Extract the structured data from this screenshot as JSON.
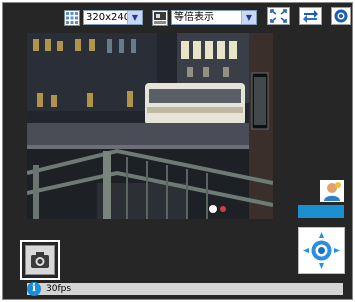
{
  "toolbar": {
    "resolution_icon": "resolution-grid-icon",
    "resolution_value": "320x240",
    "display_mode_icon": "display-mode-icon",
    "display_mode_value": "等倍表示",
    "fullscreen_icon": "fullscreen-icon",
    "swap_icon": "swap-arrows-icon",
    "settings_icon": "camera-settings-icon"
  },
  "video": {
    "alt": "Live camera feed: night street with bus and overpass"
  },
  "side": {
    "user_icon": "user-avatar-icon",
    "bar_color": "#1c8fd0",
    "joystick_icon": "pan-tilt-crosshair-icon"
  },
  "snapshot": {
    "icon": "camera-snapshot-icon"
  },
  "status": {
    "icon": "info-icon",
    "info_glyph": "i",
    "text": "30fps"
  }
}
